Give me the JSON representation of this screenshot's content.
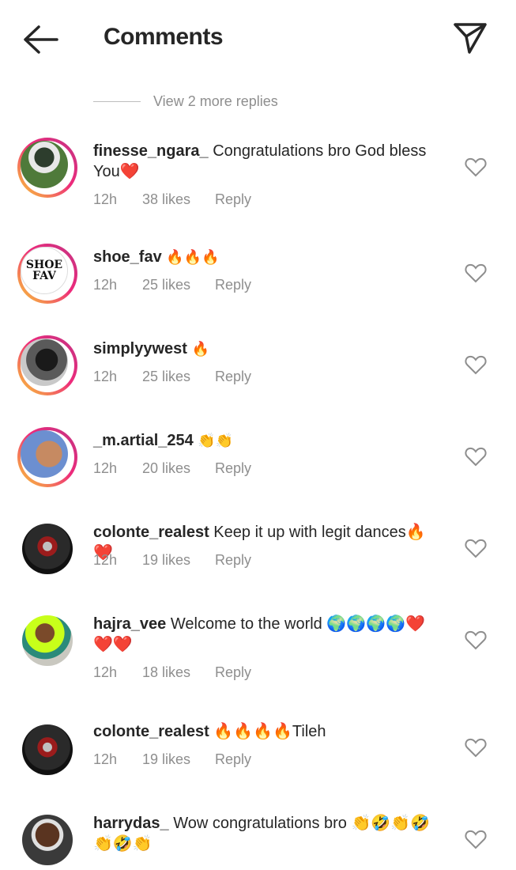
{
  "header": {
    "title": "Comments",
    "back_icon": "arrow-left-icon",
    "share_icon": "paper-plane-icon"
  },
  "view_more": "View 2 more replies",
  "comments": [
    {
      "username": "finesse_ngara_",
      "text": "Congratulations bro God bless You❤️",
      "time": "12h",
      "likes": "38 likes",
      "reply": "Reply"
    },
    {
      "username": "shoe_fav",
      "text": "🔥🔥🔥",
      "time": "12h",
      "likes": "25 likes",
      "reply": "Reply",
      "avatar_text": "SHOE FAV"
    },
    {
      "username": "simplyywest",
      "text": "🔥",
      "time": "12h",
      "likes": "25 likes",
      "reply": "Reply"
    },
    {
      "username": "_m.artial_254",
      "text": "👏👏",
      "time": "12h",
      "likes": "20 likes",
      "reply": "Reply"
    },
    {
      "username": "colonte_realest",
      "text": "Keep it up with legit dances🔥❤️",
      "time": "12h",
      "likes": "19 likes",
      "reply": "Reply"
    },
    {
      "username": "hajra_vee",
      "text": "Welcome to the world 🌍🌍🌍🌍❤️❤️❤️",
      "time": "12h",
      "likes": "18 likes",
      "reply": "Reply"
    },
    {
      "username": "colonte_realest",
      "text": "🔥🔥🔥🔥Tileh",
      "time": "12h",
      "likes": "19 likes",
      "reply": "Reply"
    },
    {
      "username": "harrydas_",
      "text": "Wow congratulations bro 👏🤣👏🤣👏🤣👏",
      "time": "",
      "likes": "",
      "reply": ""
    }
  ]
}
